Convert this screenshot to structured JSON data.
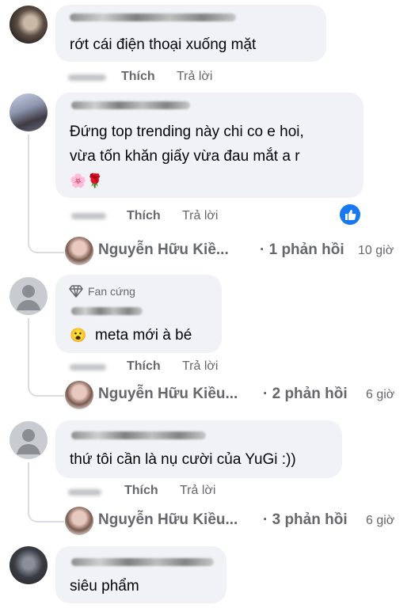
{
  "colors": {
    "bubble": "#f0f2f5",
    "secondary_text": "#65676b",
    "like_blue": "#1877f2"
  },
  "comments": [
    {
      "text": "rớt   cái điện thoại xuống mặt",
      "like_label": "Thích",
      "reply_label": "Trả lời"
    },
    {
      "text_line1": "Đứng top trending này chi co e hoi,",
      "text_line2": "vừa tốn khăn giấy vừa đau mắt a r",
      "emojis": "🌸🌹",
      "like_label": "Thích",
      "reply_label": "Trả lời",
      "reaction_icon": "like-icon",
      "replies": {
        "name": "Nguyễn Hữu Kiề...",
        "count": "· 1 phản hồi",
        "time": "10 giờ"
      }
    },
    {
      "badge": "Fan cứng",
      "badge_icon": "diamond-icon",
      "text": "meta mới à bé",
      "emoji": "😮",
      "like_label": "Thích",
      "reply_label": "Trả lời",
      "replies": {
        "name": "Nguyễn Hữu Kiều...",
        "count": "· 2 phản hồi",
        "time": "6 giờ"
      }
    },
    {
      "text": "thứ tôi cần là nụ cười của YuGi :))",
      "like_label": "Thích",
      "reply_label": "Trả lời",
      "replies": {
        "name": "Nguyễn Hữu Kiều...",
        "count": "· 3 phản hồi",
        "time": "6 giờ"
      }
    },
    {
      "text": "siêu phẩm"
    }
  ]
}
